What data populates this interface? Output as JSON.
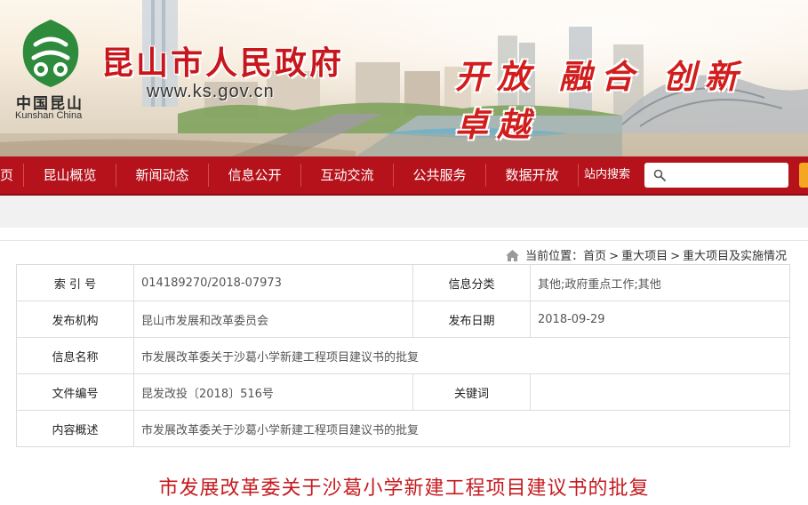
{
  "header": {
    "site_title": "昆山市人民政府",
    "site_url": "www.ks.gov.cn",
    "logo_cn": "中国昆山",
    "logo_en": "Kunshan China",
    "slogan": "开放 融合 创新 卓越",
    "accent_color": "#c8161d",
    "logo_color": "#2e8b3c"
  },
  "nav": {
    "items": [
      {
        "label": "页"
      },
      {
        "label": "昆山概览"
      },
      {
        "label": "新闻动态"
      },
      {
        "label": "信息公开"
      },
      {
        "label": "互动交流"
      },
      {
        "label": "公共服务"
      },
      {
        "label": "数据开放"
      }
    ],
    "search_label": "站内搜索",
    "search_placeholder": "",
    "bar_color": "#b5121b"
  },
  "breadcrumb": {
    "prefix": "当前位置：",
    "items": [
      "首页",
      "重大项目",
      "重大项目及实施情况"
    ],
    "separator": ">"
  },
  "info": {
    "index_label": "索 引 号",
    "index_value": "014189270/2018-07973",
    "category_label": "信息分类",
    "category_value": "其他;政府重点工作;其他",
    "publisher_label": "发布机构",
    "publisher_value": "昆山市发展和改革委员会",
    "date_label": "发布日期",
    "date_value": "2018-09-29",
    "name_label": "信息名称",
    "name_value": "市发展改革委关于沙葛小学新建工程项目建议书的批复",
    "doc_no_label": "文件编号",
    "doc_no_value": "昆发改投〔2018〕516号",
    "keyword_label": "关键词",
    "keyword_value": "",
    "summary_label": "内容概述",
    "summary_value": "市发展改革委关于沙葛小学新建工程项目建议书的批复"
  },
  "article": {
    "title": "市发展改革委关于沙葛小学新建工程项目建议书的批复"
  }
}
